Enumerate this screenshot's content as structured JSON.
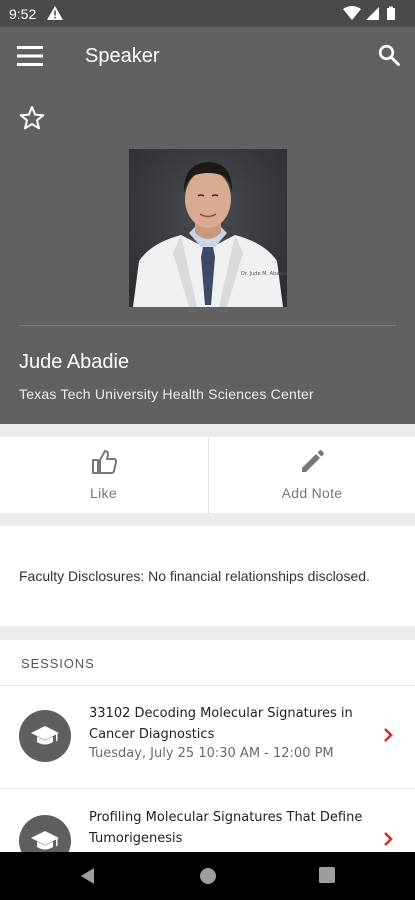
{
  "status_bar": {
    "time": "9:52"
  },
  "app_bar": {
    "title": "Speaker"
  },
  "speaker": {
    "name": "Jude Abadie",
    "organization": "Texas Tech University Health Sciences Center",
    "photo_badge": "Dr. Jude M. Abadie"
  },
  "actions": {
    "like_label": "Like",
    "note_label": "Add Note"
  },
  "disclosure": {
    "text": "Faculty Disclosures: No financial relationships disclosed."
  },
  "sessions": {
    "header": "SESSIONS",
    "items": [
      {
        "title": "33102 Decoding Molecular Signatures in Cancer Diagnostics",
        "time": "Tuesday, July 25 10:30 AM - 12:00 PM"
      },
      {
        "title": "Profiling Molecular Signatures That Define Tumorigenesis",
        "time": ""
      }
    ]
  },
  "colors": {
    "primary": "#616161",
    "accent": "#d32f2f",
    "status_bar": "#4b4b4b"
  }
}
